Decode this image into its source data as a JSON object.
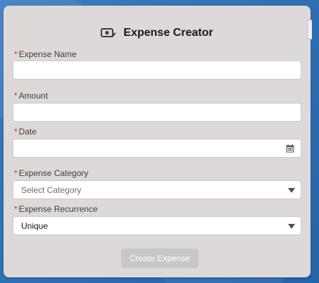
{
  "header": {
    "title": "Expense Creator",
    "icon": "expense-card-icon"
  },
  "fields": {
    "name": {
      "label": "Expense Name",
      "value": ""
    },
    "amount": {
      "label": "Amount",
      "value": ""
    },
    "date": {
      "label": "Date",
      "value": "",
      "icon": "calendar-icon"
    },
    "category": {
      "label": "Expense Category",
      "selected": "Select Category"
    },
    "recurrence": {
      "label": "Expense Recurrence",
      "selected": "Unique"
    }
  },
  "required_marker": "*",
  "actions": {
    "create_label": "Create Expense"
  },
  "colors": {
    "card": "#ded9d9",
    "required": "#c23934",
    "button_disabled": "#c9c7c5",
    "background": "#2f6fb0"
  }
}
